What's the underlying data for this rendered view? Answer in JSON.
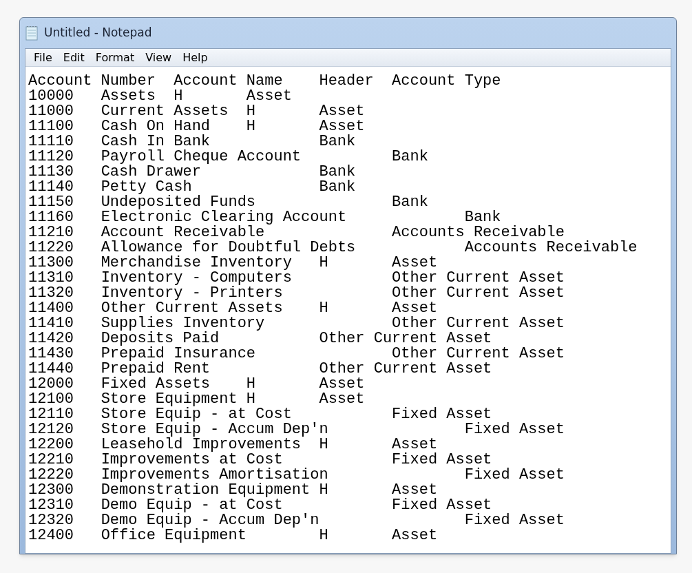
{
  "window": {
    "title": "Untitled - Notepad"
  },
  "menu": [
    "File",
    "Edit",
    "Format",
    "View",
    "Help"
  ],
  "lines": [
    "Account Number\tAccount Name\tHeader\tAccount Type",
    "10000\tAssets\tH\tAsset",
    "11000\tCurrent Assets\tH\tAsset",
    "11100\tCash On Hand\tH\tAsset",
    "11110\tCash In Bank\t\tBank",
    "11120\tPayroll Cheque Account\t\tBank",
    "11130\tCash Drawer\t\tBank",
    "11140\tPetty Cash\t\tBank",
    "11150\tUndeposited Funds\t\tBank",
    "11160\tElectronic Clearing Account\t\tBank",
    "11210\tAccount Receivable\t\tAccounts Receivable",
    "11220\tAllowance for Doubtful Debts\t\tAccounts Receivable",
    "11300\tMerchandise Inventory\tH\tAsset",
    "11310\tInventory - Computers\t\tOther Current Asset",
    "11320\tInventory - Printers\t\tOther Current Asset",
    "11400\tOther Current Assets\tH\tAsset",
    "11410\tSupplies Inventory\t\tOther Current Asset",
    "11420\tDeposits Paid\t\tOther Current Asset",
    "11430\tPrepaid Insurance\t\tOther Current Asset",
    "11440\tPrepaid Rent\t\tOther Current Asset",
    "12000\tFixed Assets\tH\tAsset",
    "12100\tStore Equipment H\tAsset",
    "12110\tStore Equip - at Cost\t\tFixed Asset",
    "12120\tStore Equip - Accum Dep'n\t\tFixed Asset",
    "12200\tLeasehold Improvements\tH\tAsset",
    "12210\tImprovements at Cost\t\tFixed Asset",
    "12220\tImprovements Amortisation\t\tFixed Asset",
    "12300\tDemonstration Equipment H\tAsset",
    "12310\tDemo Equip - at Cost\t\tFixed Asset",
    "12320\tDemo Equip - Accum Dep'n\t\tFixed Asset",
    "12400\tOffice Equipment\tH\tAsset"
  ]
}
